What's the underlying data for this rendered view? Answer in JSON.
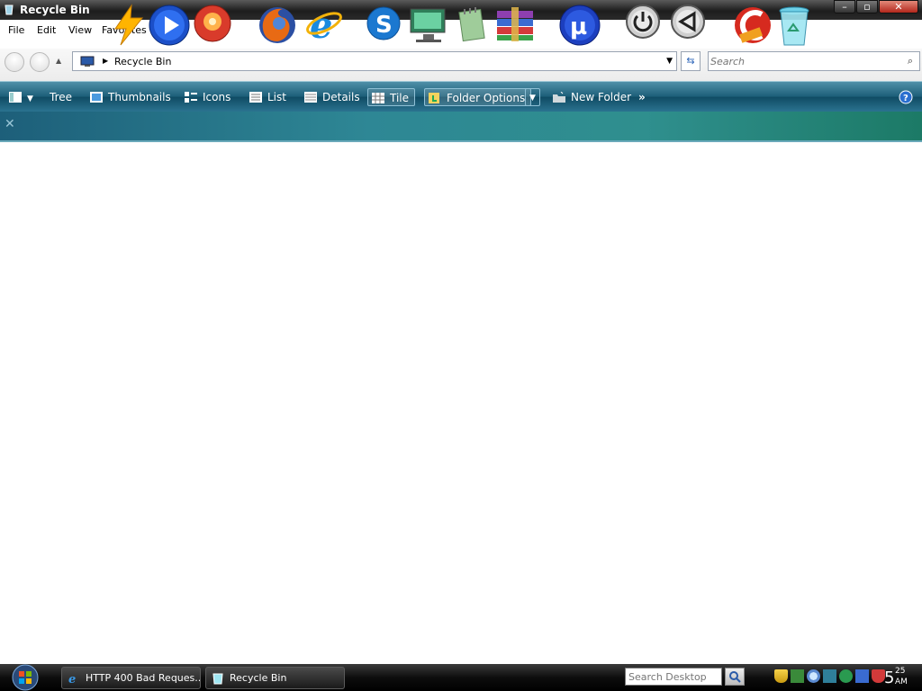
{
  "window": {
    "title": "Recycle Bin"
  },
  "menu": {
    "file": "File",
    "edit": "Edit",
    "view": "View",
    "favorites": "Favorites"
  },
  "address": {
    "crumb": "Recycle Bin"
  },
  "search": {
    "placeholder": "Search"
  },
  "toolbar": {
    "tree": "Tree",
    "thumbnails": "Thumbnails",
    "icons": "Icons",
    "list": "List",
    "details": "Details",
    "tile": "Tile",
    "folder_options": "Folder Options",
    "new_folder": "New Folder",
    "more": "»"
  },
  "dock": {
    "icons": [
      "lightning-icon",
      "play-icon",
      "burning-disc-icon",
      "firefox-icon",
      "internet-explorer-icon",
      "skype-icon",
      "monitor-icon",
      "notepad-icon",
      "winrar-icon",
      "utorrent-icon",
      "power-icon",
      "back-arrow-icon",
      "ccleaner-icon",
      "recycle-bin-icon"
    ]
  },
  "taskbar": {
    "items": [
      {
        "label": "HTTP 400 Bad Reques..."
      },
      {
        "label": "Recycle Bin"
      }
    ],
    "search_placeholder": "Search Desktop",
    "clock": {
      "hour": "5",
      "minute": "25",
      "ampm": "AM"
    }
  },
  "colors": {
    "toolbar": "#1c5e78",
    "banner": "#2e8795",
    "titlebar": "#1d1d1d",
    "taskbar": "#0d0d0d"
  }
}
